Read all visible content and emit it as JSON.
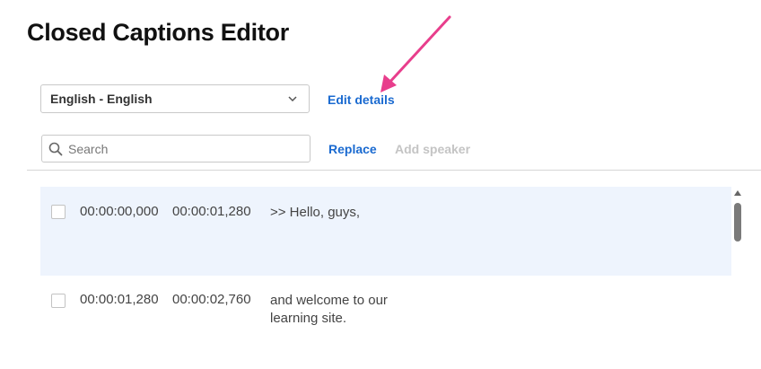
{
  "header": {
    "title": "Closed Captions Editor"
  },
  "language_select": {
    "selected": "English - English"
  },
  "actions": {
    "edit_details": "Edit details",
    "replace": "Replace",
    "add_speaker": "Add speaker"
  },
  "search": {
    "placeholder": "Search",
    "value": ""
  },
  "captions": [
    {
      "start": "00:00:00,000",
      "end": "00:00:01,280",
      "text": ">> Hello, guys,",
      "selected": true,
      "checked": false
    },
    {
      "start": "00:00:01,280",
      "end": "00:00:02,760",
      "text": "and welcome to our learning site.",
      "selected": false,
      "checked": false
    }
  ],
  "colors": {
    "link": "#1a6ad0",
    "disabled": "#c4c4c4",
    "selected_row_bg": "#eef4fd",
    "annotation_arrow": "#e83e8c"
  },
  "icons": {
    "dropdown": "chevron-down-icon",
    "search": "magnifier-icon",
    "annotation": "pink-arrow"
  }
}
